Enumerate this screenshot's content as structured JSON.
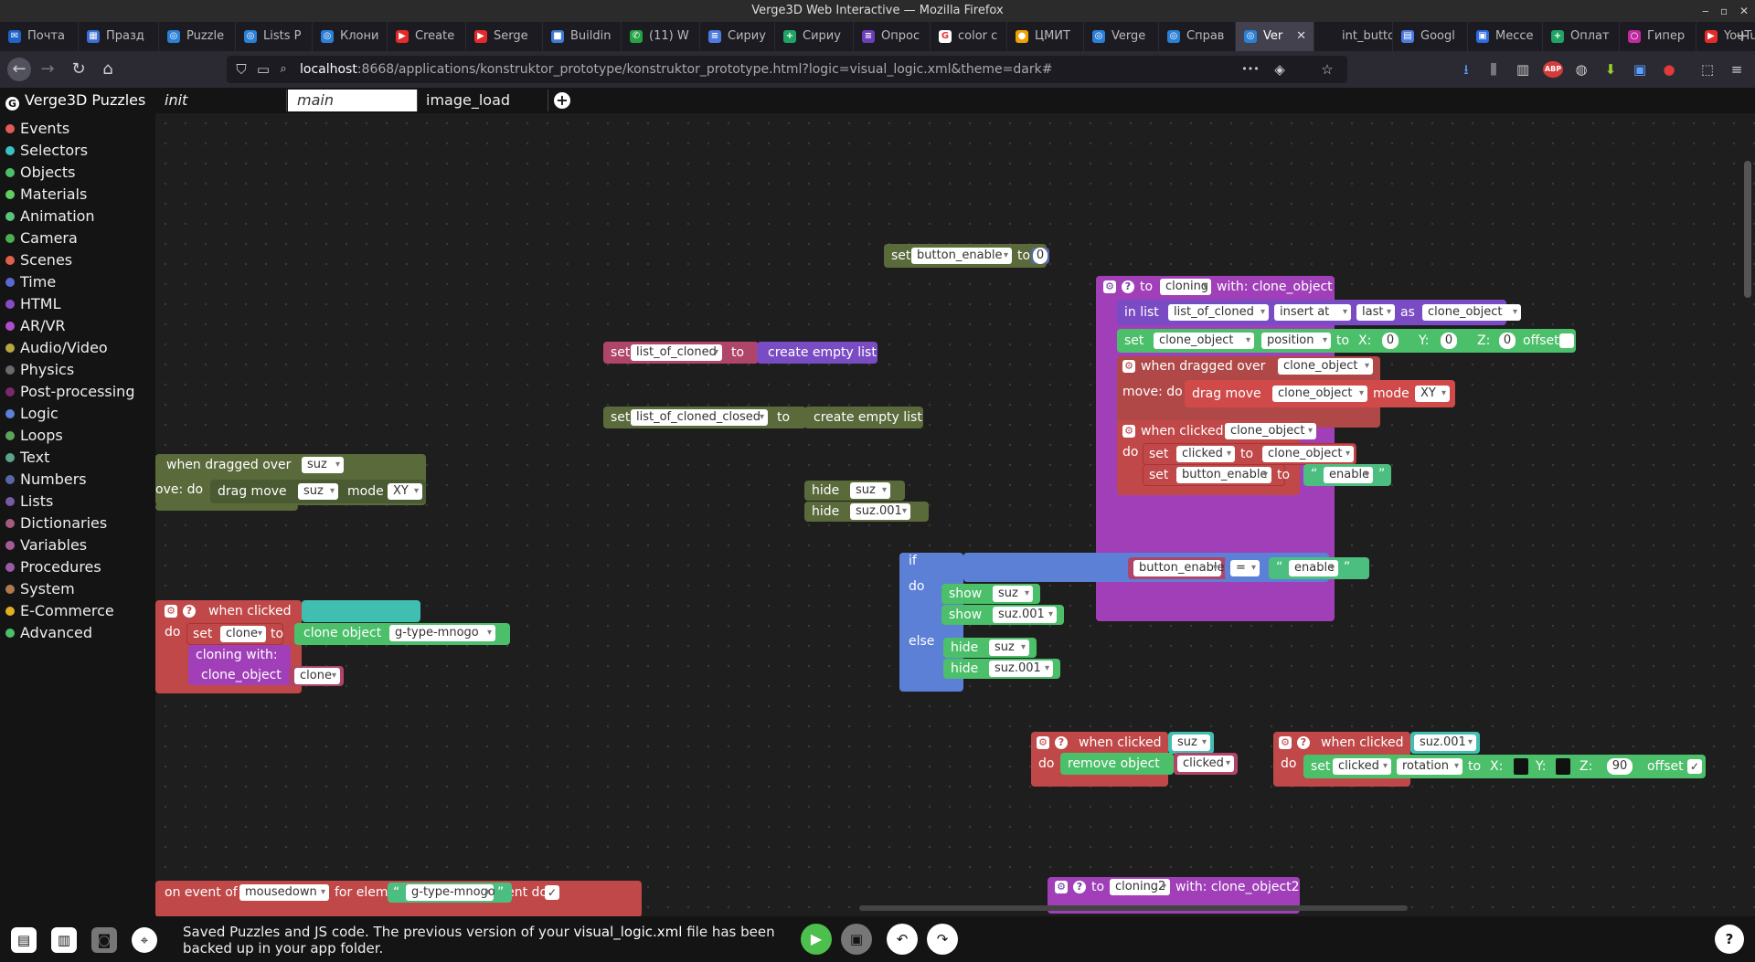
{
  "window": {
    "title": "Verge3D Web Interactive — Mozilla Firefox",
    "min": "‒",
    "max": "▫",
    "close": "✕"
  },
  "tabs": [
    {
      "label": "Почта",
      "icon": "✉",
      "color": "#1e63c9"
    },
    {
      "label": "Празд",
      "icon": "▦",
      "color": "#3b6fd6"
    },
    {
      "label": "Puzzle",
      "icon": "◎",
      "color": "#2a7fd6"
    },
    {
      "label": "Lists P",
      "icon": "◎",
      "color": "#2a7fd6"
    },
    {
      "label": "Клони",
      "icon": "◎",
      "color": "#2a7fd6"
    },
    {
      "label": "Create",
      "icon": "▶",
      "color": "#e52a2a"
    },
    {
      "label": "Serge",
      "icon": "▶",
      "color": "#e52a2a"
    },
    {
      "label": "Buildin",
      "icon": "■",
      "color": "#3e7bd6"
    },
    {
      "label": "(11) W",
      "icon": "✆",
      "color": "#25a244"
    },
    {
      "label": "Сириу",
      "icon": "≡",
      "color": "#4b7be0"
    },
    {
      "label": "Сириу",
      "icon": "+",
      "color": "#1fa463"
    },
    {
      "label": "Опрос",
      "icon": "≡",
      "color": "#6a3fb8"
    },
    {
      "label": "color c",
      "icon": "G",
      "color": "#ffffff"
    },
    {
      "label": "ЦМИТ",
      "icon": "●",
      "color": "#f2a000"
    },
    {
      "label": "Verge",
      "icon": "◎",
      "color": "#2a7fd6"
    },
    {
      "label": "Справ",
      "icon": "◎",
      "color": "#2a7fd6"
    },
    {
      "label": "Ver",
      "icon": "◎",
      "color": "#2a7fd6",
      "close": "✕"
    },
    {
      "label": "int_button",
      "icon": "",
      "color": "#1c1b22"
    },
    {
      "label": "Googl",
      "icon": "▤",
      "color": "#4b7be0"
    },
    {
      "label": "Мессе",
      "icon": "▣",
      "color": "#2d6be0"
    },
    {
      "label": "Оплат",
      "icon": "+",
      "color": "#1fa463"
    },
    {
      "label": "Гипер",
      "icon": "○",
      "color": "#c02aa0"
    },
    {
      "label": "YouTu",
      "icon": "▶",
      "color": "#e52a2a"
    }
  ],
  "newtab": "+",
  "nav": {
    "back": "←",
    "forward": "→",
    "reload": "↻",
    "home": "⌂",
    "url_host": "localhost",
    "url_rest": ":8668/applications/konstruktor_prototype/konstruktor_prototype.html?logic=visual_logic.xml&theme=dark#",
    "more": "•••",
    "shield": "⛉",
    "page": "▭",
    "star": "☆",
    "pocket": "◈",
    "reader": "⌕",
    "download": "⭳",
    "library": "⫼",
    "sidebar": "▥",
    "abp": "ABP",
    "globe": "◍",
    "ext1": "⬇",
    "ext2": "▣",
    "ext3": "●",
    "ext4": "⬚",
    "menu": "≡"
  },
  "header": {
    "logo_mark": "G",
    "title": "Verge3D Puzzles",
    "tabs": [
      "init",
      "main",
      "image_load"
    ],
    "add": "+"
  },
  "categories": [
    {
      "label": "Events",
      "color": "#e05a5a"
    },
    {
      "label": "Selectors",
      "color": "#3ac2c2"
    },
    {
      "label": "Objects",
      "color": "#4cbf6a"
    },
    {
      "label": "Materials",
      "color": "#5fd05f"
    },
    {
      "label": "Animation",
      "color": "#58c47c"
    },
    {
      "label": "Camera",
      "color": "#4caf50"
    },
    {
      "label": "Scenes",
      "color": "#e0604e"
    },
    {
      "label": "Time",
      "color": "#5b67d4"
    },
    {
      "label": "HTML",
      "color": "#8a4cc4"
    },
    {
      "label": "AR/VR",
      "color": "#b04cd0"
    },
    {
      "label": "Audio/Video",
      "color": "#b8a640"
    },
    {
      "label": "Physics",
      "color": "#6a6a6a"
    },
    {
      "label": "Post-processing",
      "color": "#7a2a6a"
    },
    {
      "label": "Logic",
      "color": "#5b80d6"
    },
    {
      "label": "Loops",
      "color": "#5ba55b"
    },
    {
      "label": "Text",
      "color": "#5ba58c"
    },
    {
      "label": "Numbers",
      "color": "#5b67a5"
    },
    {
      "label": "Lists",
      "color": "#745ba5"
    },
    {
      "label": "Dictionaries",
      "color": "#a55b80"
    },
    {
      "label": "Variables",
      "color": "#a55b99"
    },
    {
      "label": "Procedures",
      "color": "#995ba5"
    },
    {
      "label": "System",
      "color": "#b07a50"
    },
    {
      "label": "E-Commerce",
      "color": "#e0b020"
    },
    {
      "label": "Advanced",
      "color": "#4cbf6a"
    }
  ],
  "blocks": {
    "set_btn": {
      "kw": "set",
      "var": "button_enable",
      "to": "to",
      "val": "0"
    },
    "set_list": {
      "kw": "set",
      "var": "list_of_cloned",
      "to": "to",
      "val": "create empty list"
    },
    "set_list_closed": {
      "kw": "set",
      "var": "list_of_cloned_closed",
      "to": "to",
      "val": "create empty list"
    },
    "drag_left": {
      "head": "when dragged over",
      "obj": "suz",
      "move": "ove: do",
      "drag": "drag move",
      "obj2": "suz",
      "mode": "mode",
      "modeval": "XY"
    },
    "hide1": {
      "kw": "hide",
      "obj": "suz"
    },
    "hide2": {
      "kw": "hide",
      "obj": "suz.001"
    },
    "cloning": {
      "gear": "⚙",
      "help": "?",
      "to": "to",
      "name": "cloning",
      "with": "with: clone_object",
      "inlist": "in list",
      "list": "list_of_cloned",
      "insertat": "insert at",
      "last": "last",
      "as": "as",
      "asval": "clone_object",
      "set": "set",
      "setobj": "clone_object",
      "prop": "position",
      "to2": "to",
      "x": "X:",
      "xv": "0",
      "y": "Y:",
      "yv": "0",
      "z": "Z:",
      "zv": "0",
      "offset": "offset",
      "dragged": "when dragged over",
      "dobj": "clone_object",
      "movedo": "move: do",
      "dragmove": "drag move",
      "dmobj": "clone_object",
      "mode": "mode",
      "modeval": "XY",
      "clicked": "when clicked",
      "cobj": "clone_object",
      "do": "do",
      "set1": "set",
      "var1": "clicked",
      "to3": "to",
      "val1": "clone_object",
      "set2": "set",
      "var2": "button_enable",
      "to4": "to",
      "val2": "enable"
    },
    "ifblock": {
      "if": "if",
      "var": "button_enable",
      "op": "=",
      "val": "enable",
      "do": "do",
      "show": "show",
      "s1": "suz",
      "s2": "suz.001",
      "else": "else",
      "hide": "hide",
      "h1": "suz",
      "h2": "suz.001"
    },
    "click_g": {
      "gear": "⚙",
      "help": "?",
      "head": "when clicked",
      "obj": "g-type-mnogo",
      "do": "do",
      "set": "set",
      "var": "clone",
      "to": "to",
      "clone": "clone object",
      "cobj": "g-type-mnogo",
      "call": "cloning  with:",
      "arg": "clone_object",
      "argval": "clone"
    },
    "click_suz": {
      "gear": "⚙",
      "help": "?",
      "head": "when clicked",
      "obj": "suz",
      "do": "do",
      "remove": "remove object",
      "robj": "clicked"
    },
    "click_suz001": {
      "gear": "⚙",
      "help": "?",
      "head": "when clicked",
      "obj": "suz.001",
      "do": "do",
      "set": "set",
      "sobj": "clicked",
      "prop": "rotation",
      "to": "to",
      "x": "X:",
      "y": "Y:",
      "z": "Z:",
      "zv": "90",
      "offset": "offset",
      "check": "✓"
    },
    "event": {
      "on": "on event of",
      "ev": "mousedown",
      "for": "for elem",
      "elem": "g-type-mnogo",
      "parent": "in parent doc",
      "check": "✓"
    },
    "cloning2": {
      "gear": "⚙",
      "help": "?",
      "to": "to",
      "name": "cloning2",
      "with": "with: clone_object2"
    }
  },
  "status": {
    "msg1a": "Saved Puzzles and JS code. The previous version of your ",
    "file": "visual_logic.xml",
    "msg1b": " file has been",
    "msg2": "backed up in your app folder.",
    "help": "?"
  }
}
